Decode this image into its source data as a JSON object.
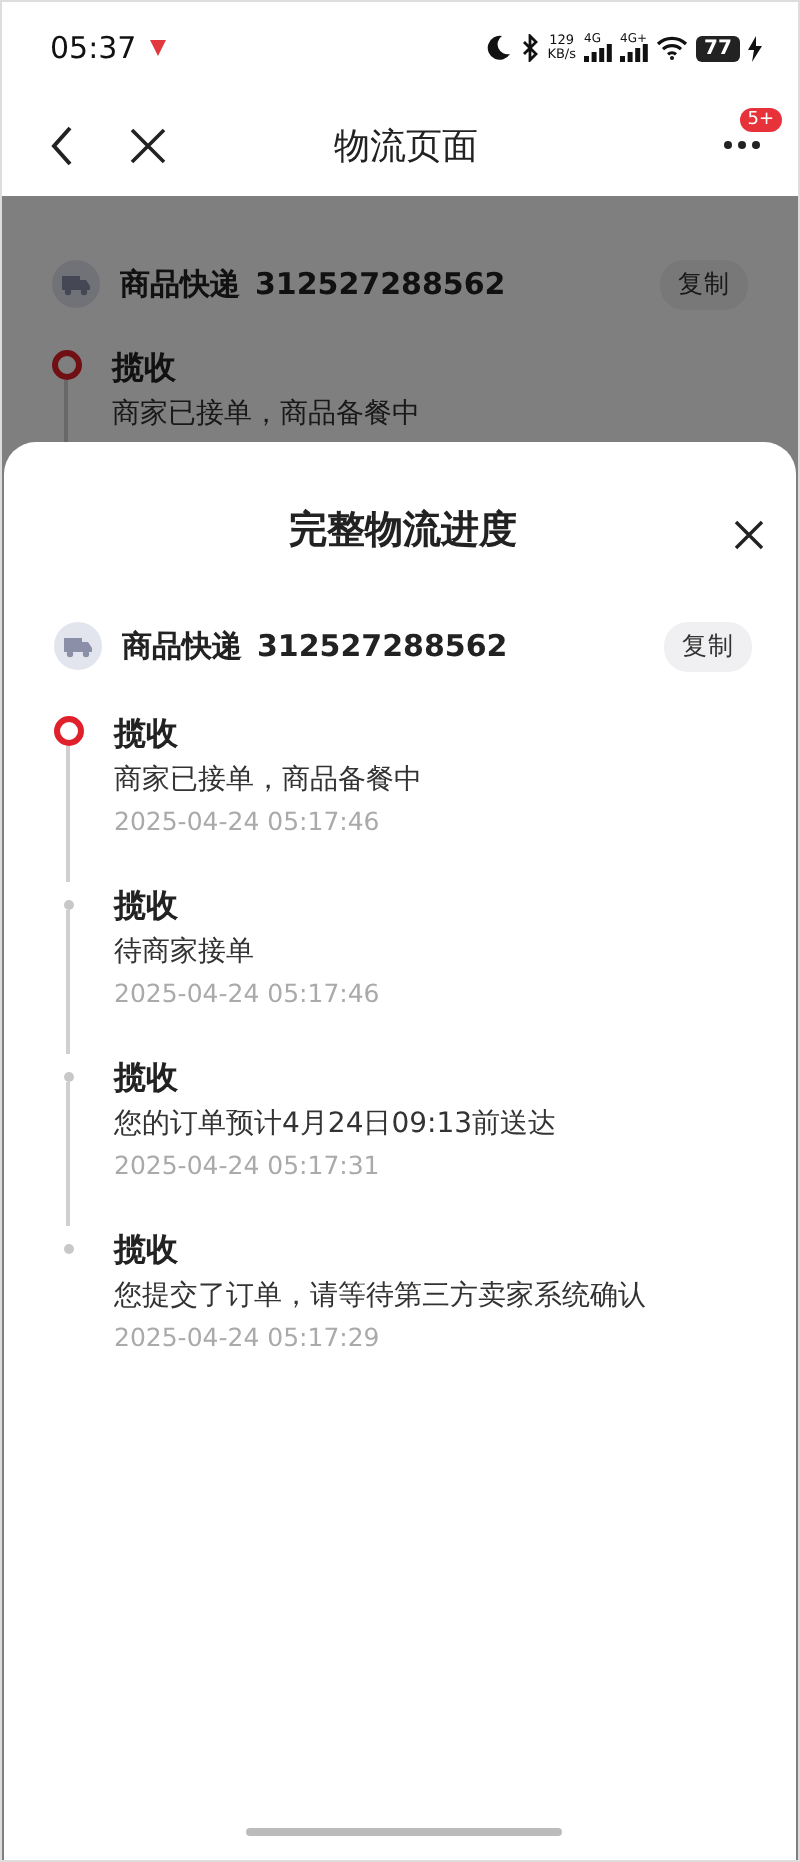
{
  "status_bar": {
    "time": "05:37",
    "speed": "129",
    "speed_unit": "KB/s",
    "networks": [
      "4G",
      "4G+"
    ],
    "battery": "77"
  },
  "nav": {
    "title": "物流页面",
    "badge": "5+"
  },
  "background": {
    "courier": {
      "name": "商品快递",
      "number": "312527288562"
    },
    "copy_button": "复制",
    "event": {
      "title": "揽收",
      "description": "商家已接单，商品备餐中",
      "current": true
    }
  },
  "sheet": {
    "title": "完整物流进度",
    "courier": {
      "name": "商品快递",
      "number": "312527288562"
    },
    "copy_button": "复制",
    "events": [
      {
        "title": "揽收",
        "description": "商家已接单，商品备餐中",
        "time": "2025-04-24 05:17:46",
        "current": true
      },
      {
        "title": "揽收",
        "description": "待商家接单",
        "time": "2025-04-24 05:17:46",
        "current": false
      },
      {
        "title": "揽收",
        "description": "您的订单预计4月24日09:13前送达",
        "time": "2025-04-24 05:17:31",
        "current": false
      },
      {
        "title": "揽收",
        "description": "您提交了订单，请等待第三方卖家系统确认",
        "time": "2025-04-24 05:17:29",
        "current": false
      }
    ]
  }
}
